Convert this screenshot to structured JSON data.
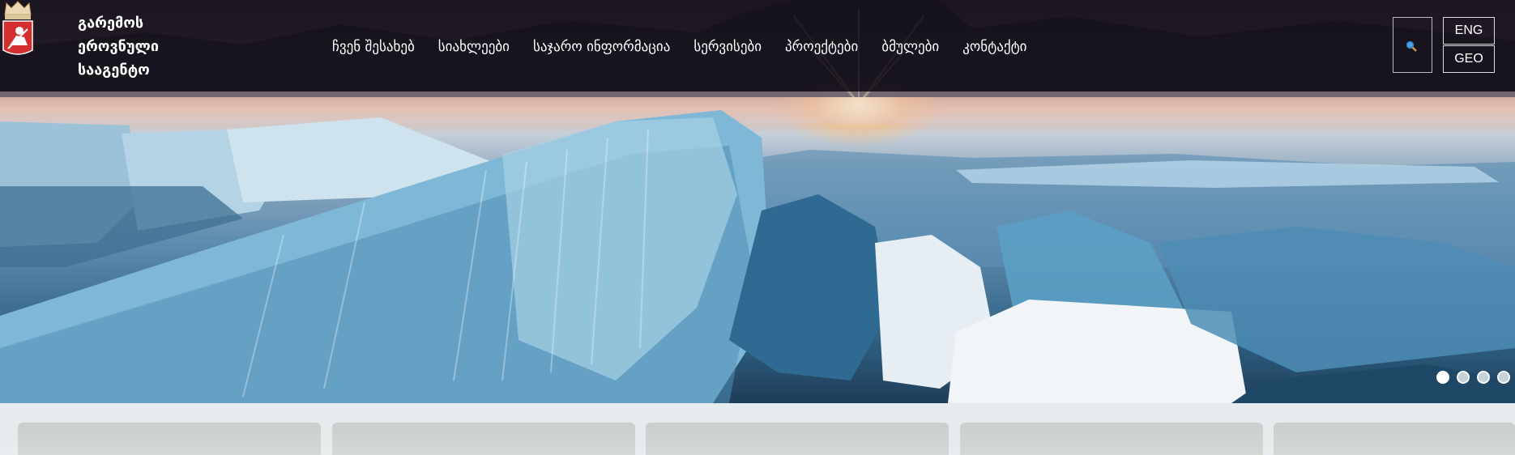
{
  "agency": {
    "name_lines": [
      "გარემოს",
      "ეროვნული",
      "სააგენტო"
    ]
  },
  "nav": {
    "items": [
      "ჩვენ შესახებ",
      "სიახლეები",
      "საჯარო ინფორმაცია",
      "სერვისები",
      "პროექტები",
      "ბმულები",
      "კონტაქტი"
    ]
  },
  "header": {
    "search_icon": "search-icon",
    "lang_eng": "ENG",
    "lang_geo": "GEO"
  },
  "slider": {
    "dot_count": 4,
    "active_index": 0
  },
  "colors": {
    "header_bg": "#12101a",
    "text": "#ffffff",
    "crest_red": "#d32f2f"
  }
}
